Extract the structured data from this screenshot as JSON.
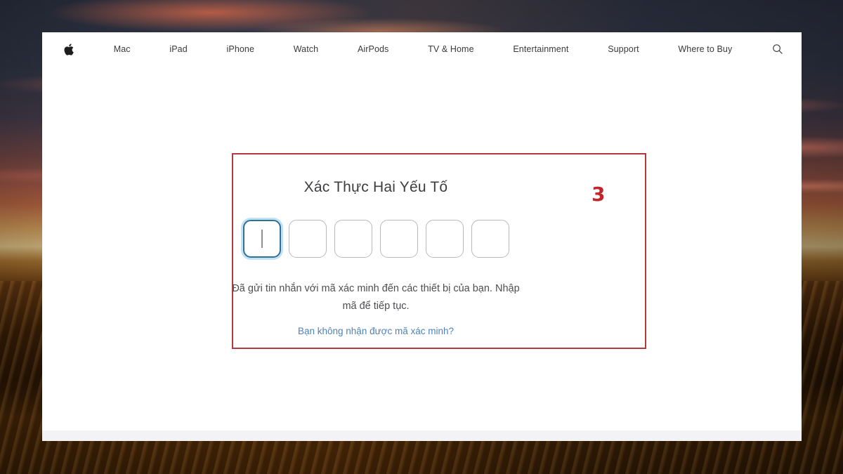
{
  "background": {
    "scene": "desert-sunset-wallpaper",
    "sky_color": "#2e3344",
    "cloud_color": "#e06a46",
    "sand_color": "#6e3e12"
  },
  "nav": {
    "logo_icon": "apple-logo-icon",
    "search_icon": "search-icon",
    "items": [
      {
        "label": "Mac"
      },
      {
        "label": "iPad"
      },
      {
        "label": "iPhone"
      },
      {
        "label": "Watch"
      },
      {
        "label": "AirPods"
      },
      {
        "label": "TV & Home"
      },
      {
        "label": "Entertainment"
      },
      {
        "label": "Support"
      },
      {
        "label": "Where to Buy"
      }
    ]
  },
  "twofa": {
    "title": "Xác Thực Hai Yếu Tố",
    "code_boxes": [
      {
        "value": "",
        "focused": true
      },
      {
        "value": "",
        "focused": false
      },
      {
        "value": "",
        "focused": false
      },
      {
        "value": "",
        "focused": false
      },
      {
        "value": "",
        "focused": false
      },
      {
        "value": "",
        "focused": false
      }
    ],
    "message": "Đã gửi tin nhắn với mã xác minh đến các thiết bị của bạn. Nhập mã để tiếp tục.",
    "resend_link": "Bạn không nhận được mã xác minh?",
    "link_color": "#4e82b4",
    "focus_border_color": "#2f7294"
  },
  "annotation": {
    "number": "3",
    "color": "#c0272d",
    "box_border_color": "#b03a3c"
  }
}
